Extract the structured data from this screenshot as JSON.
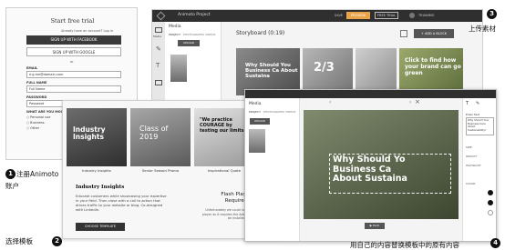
{
  "panel1": {
    "title": "Start free trial",
    "already_text": "Already have an account? Log in",
    "facebook_button": "SIGN UP WITH FACEBOOK",
    "google_button": "SIGN UP WITH GOOGLE",
    "divider": "or",
    "email_label": "EMAIL",
    "email_value": "e.g.me@domain.com",
    "fullname_label": "FULL NAME",
    "fullname_value": "Full Name",
    "password_label": "PASSWORD",
    "password_value": "Password",
    "question_label": "WHAT ARE YOU MOST LIKELY TO USE ANIMOTO FOR?",
    "radio_options": [
      "Personal use",
      "Business",
      "Other"
    ],
    "annotation_num": "1",
    "annotation_text_line1": "注册Animoto",
    "annotation_text_line2": "账户"
  },
  "panel2": {
    "thumbs": [
      {
        "title_line1": "Industry",
        "title_line2": "Insights",
        "caption": "Industry Insights"
      },
      {
        "title_line1": "Class of",
        "title_line2": "2019",
        "caption": "Senior Season Promo"
      },
      {
        "title_line1": "\"We practice",
        "title_line2": "COURAGE by testing our limits.\"",
        "caption": "Inspirational Quote"
      }
    ],
    "heading": "Industry Insights",
    "body": "Educate customers while showcasing your expertise in your field. Then close with a call to action that drives traffic to your website or blog. Co-designed with LinkedIn.",
    "button": "CHOOSE TEMPLATE",
    "flash_title_line1": "Flash Player",
    "flash_title_line2": "Required",
    "flash_text": "Unfortunately we could not load the video player as it requires the Adobe Flash Player to be installed.",
    "annotation_num": "2",
    "annotation_text": "选择模板"
  },
  "panel3": {
    "project_title": "Animoto Project",
    "top_links": [
      "SAVE",
      "PREVIEW",
      "FREE TRIAL"
    ],
    "user": "TRIANIMO",
    "sidebar_items": [
      "Media",
      "Design",
      "Text",
      "Style"
    ],
    "media_header": "Media",
    "media_tabs": [
      "PROJECT",
      "PHOTOGRAPHS",
      "VIDEOS"
    ],
    "upload_button": "UPLOAD",
    "storyboard_title": "Storyboard (0:19)",
    "add_block_button": "+ ADD A BLOCK",
    "slides": [
      "Why Should You Business Ca About Sustaina",
      "2/3",
      "Click to find how your brand can go green"
    ],
    "annotation_num": "3",
    "annotation_text": "上传素材"
  },
  "panel4": {
    "media_header": "Media",
    "media_tabs": [
      "PROJECT",
      "PHOTOGRAPHS",
      "VIDEOS"
    ],
    "upload_button": "UPLOAD",
    "slide_text_line1": "Why Should Yo",
    "slide_text_line2": "Business Ca",
    "slide_text_line3": "About Sustaina",
    "play_button": "▶ PLAY",
    "right_panel_label": "Enter Text",
    "right_panel_text": "Why Should Your Business Care About Sustainability?",
    "options": [
      "SIZE",
      "OPACITY",
      "HIGHLIGHT",
      "COLOR"
    ],
    "annotation_num": "4",
    "annotation_text": "用自己的内容替换模板中的原有内容"
  },
  "colors": {
    "dark_bar": "#2f2f2f",
    "accent_orange": "#e9a44a",
    "slide_green": "#6f8a4a"
  }
}
